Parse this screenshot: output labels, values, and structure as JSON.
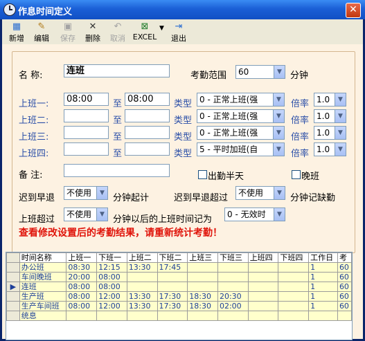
{
  "window": {
    "title": "作息时间定义"
  },
  "toolbar": {
    "items": [
      {
        "label": "新增",
        "icon": "new-icon",
        "enabled": true
      },
      {
        "label": "编辑",
        "icon": "edit-icon",
        "enabled": true
      },
      {
        "label": "保存",
        "icon": "save-icon",
        "enabled": false
      },
      {
        "label": "删除",
        "icon": "delete-icon",
        "enabled": true
      },
      {
        "label": "取消",
        "icon": "cancel-icon",
        "enabled": false
      },
      {
        "label": "EXCEL",
        "icon": "excel-icon",
        "enabled": true
      },
      {
        "label": "退出",
        "icon": "exit-icon",
        "enabled": true
      }
    ]
  },
  "form": {
    "name_label": "名  称:",
    "name_value": "连班",
    "range_label": "考勤范围",
    "range_value": "60",
    "range_unit": "分钟",
    "shift_labels": [
      "上班一:",
      "上班二:",
      "上班三:",
      "上班四:"
    ],
    "to_label": "至",
    "type_label": "类型",
    "rate_label": "倍率",
    "shifts": [
      {
        "start": "08:00",
        "end": "08:00",
        "type": "0 - 正常上班(强",
        "rate": "1.0"
      },
      {
        "start": "",
        "end": "",
        "type": "0 - 正常上班(强",
        "rate": "1.0"
      },
      {
        "start": "",
        "end": "",
        "type": "0 - 正常上班(强",
        "rate": "1.0"
      },
      {
        "start": "",
        "end": "",
        "type": "5 - 平时加班(自",
        "rate": "1.0"
      }
    ],
    "remark_label": "备  注:",
    "remark_value": "",
    "half_day_label": "出勤半天",
    "night_label": "晚班",
    "late_label": "迟到早退",
    "late_value": "不使用",
    "late_unit": "分钟起计",
    "late_over_label": "迟到早退超过",
    "late_over_value": "不使用",
    "late_over_unit": "分钟记缺勤",
    "over_label": "上班超过",
    "over_value": "不使用",
    "over_suffix": "分钟以后的上班时间记为",
    "over_type_value": "0 - 无效时",
    "warning": "查看修改设置后的考勤结果，请重新统计考勤！"
  },
  "grid": {
    "columns": [
      "时间名称",
      "上班一",
      "下班一",
      "上班二",
      "下班二",
      "上班三",
      "下班三",
      "上班四",
      "下班四",
      "工作日",
      "考"
    ],
    "rows": [
      [
        "办公班",
        "08:30",
        "12:15",
        "13:30",
        "17:45",
        "",
        "",
        "",
        "",
        "1",
        "60"
      ],
      [
        "车间晚班",
        "20:00",
        "08:00",
        "",
        "",
        "",
        "",
        "",
        "",
        "1",
        "60"
      ],
      [
        "连班",
        "08:00",
        "08:00",
        "",
        "",
        "",
        "",
        "",
        "",
        "1",
        "60"
      ],
      [
        "生产班",
        "08:00",
        "12:00",
        "13:30",
        "17:30",
        "18:30",
        "20:30",
        "",
        "",
        "1",
        "60"
      ],
      [
        "生产车间班",
        "08:00",
        "12:00",
        "13:30",
        "17:30",
        "18:30",
        "02:00",
        "",
        "",
        "1",
        "60"
      ],
      [
        "统息",
        "",
        "",
        "",
        "",
        "",
        "",
        "",
        "",
        "",
        ""
      ]
    ],
    "current_row": 2
  }
}
